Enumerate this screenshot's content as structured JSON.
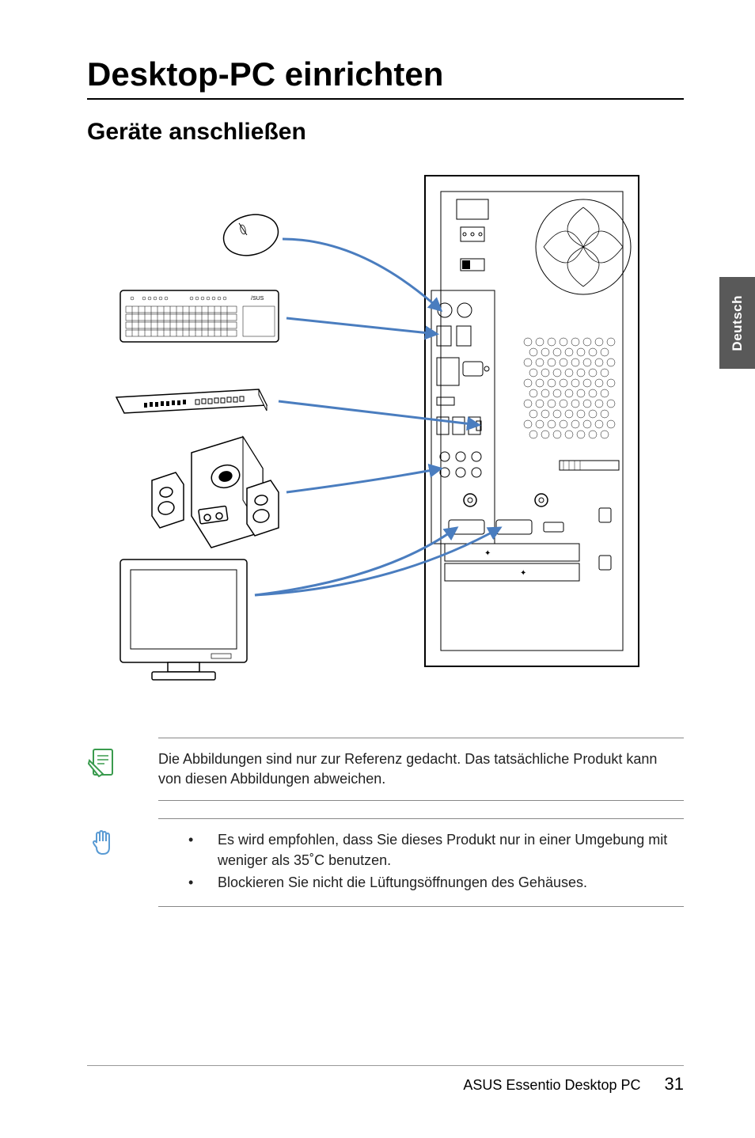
{
  "main_title": "Desktop-PC einrichten",
  "section_title": "Geräte anschließen",
  "side_tab": "Deutsch",
  "note1": "Die Abbildungen sind nur zur Referenz gedacht. Das tatsächliche Produkt kann von diesen Abbildungen abweichen.",
  "note2_bullets": [
    "Es wird empfohlen, dass Sie dieses Produkt nur in einer Umgebung mit weniger als 35˚C benutzen.",
    "Blockieren Sie nicht die Lüftungsöffnungen des Gehäuses."
  ],
  "footer_text": "ASUS Essentio Desktop PC",
  "page_number": "31"
}
